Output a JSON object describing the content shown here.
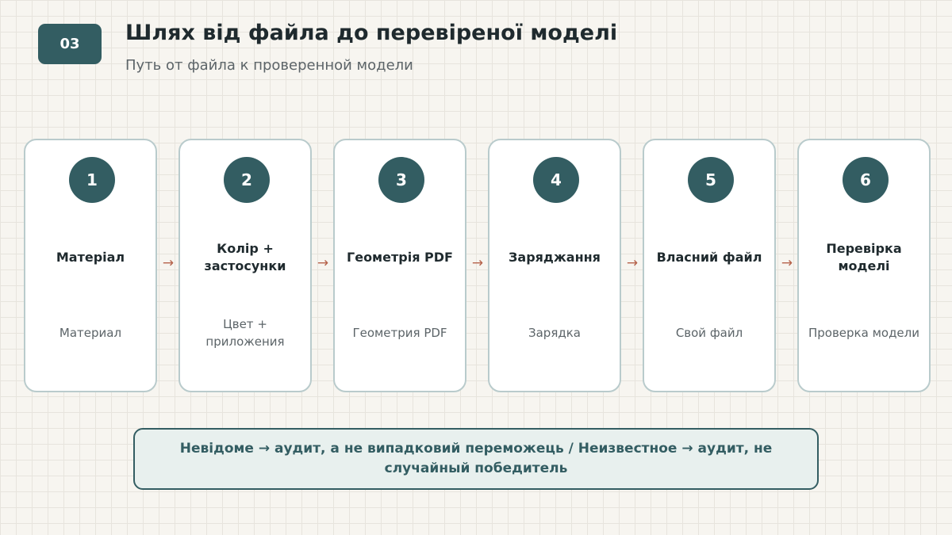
{
  "slide": {
    "badge": "03",
    "title": "Шлях від файла до перевіреної моделі",
    "subtitle": "Путь от файла к проверенной модели"
  },
  "steps": [
    {
      "number": "1",
      "title": "Матеріал",
      "subtitle": "Материал"
    },
    {
      "number": "2",
      "title": "Колір + застосунки",
      "subtitle": "Цвет + приложения"
    },
    {
      "number": "3",
      "title": "Геометрія PDF",
      "subtitle": "Геометрия PDF"
    },
    {
      "number": "4",
      "title": "Заряджання",
      "subtitle": "Зарядка"
    },
    {
      "number": "5",
      "title": "Власний файл",
      "subtitle": "Свой файл"
    },
    {
      "number": "6",
      "title": "Перевірка моделі",
      "subtitle": "Проверка модели"
    }
  ],
  "connector": "→",
  "note": "Невідоме → аудит, а не випадковий переможець  /  Неизвестное → аудит, не случайный победитель",
  "colors": {
    "accent": "#335d62",
    "arrow": "#b5624b",
    "card_border": "#b9cbcc",
    "note_background": "#e8f0ee",
    "background": "#f7f5f0"
  }
}
